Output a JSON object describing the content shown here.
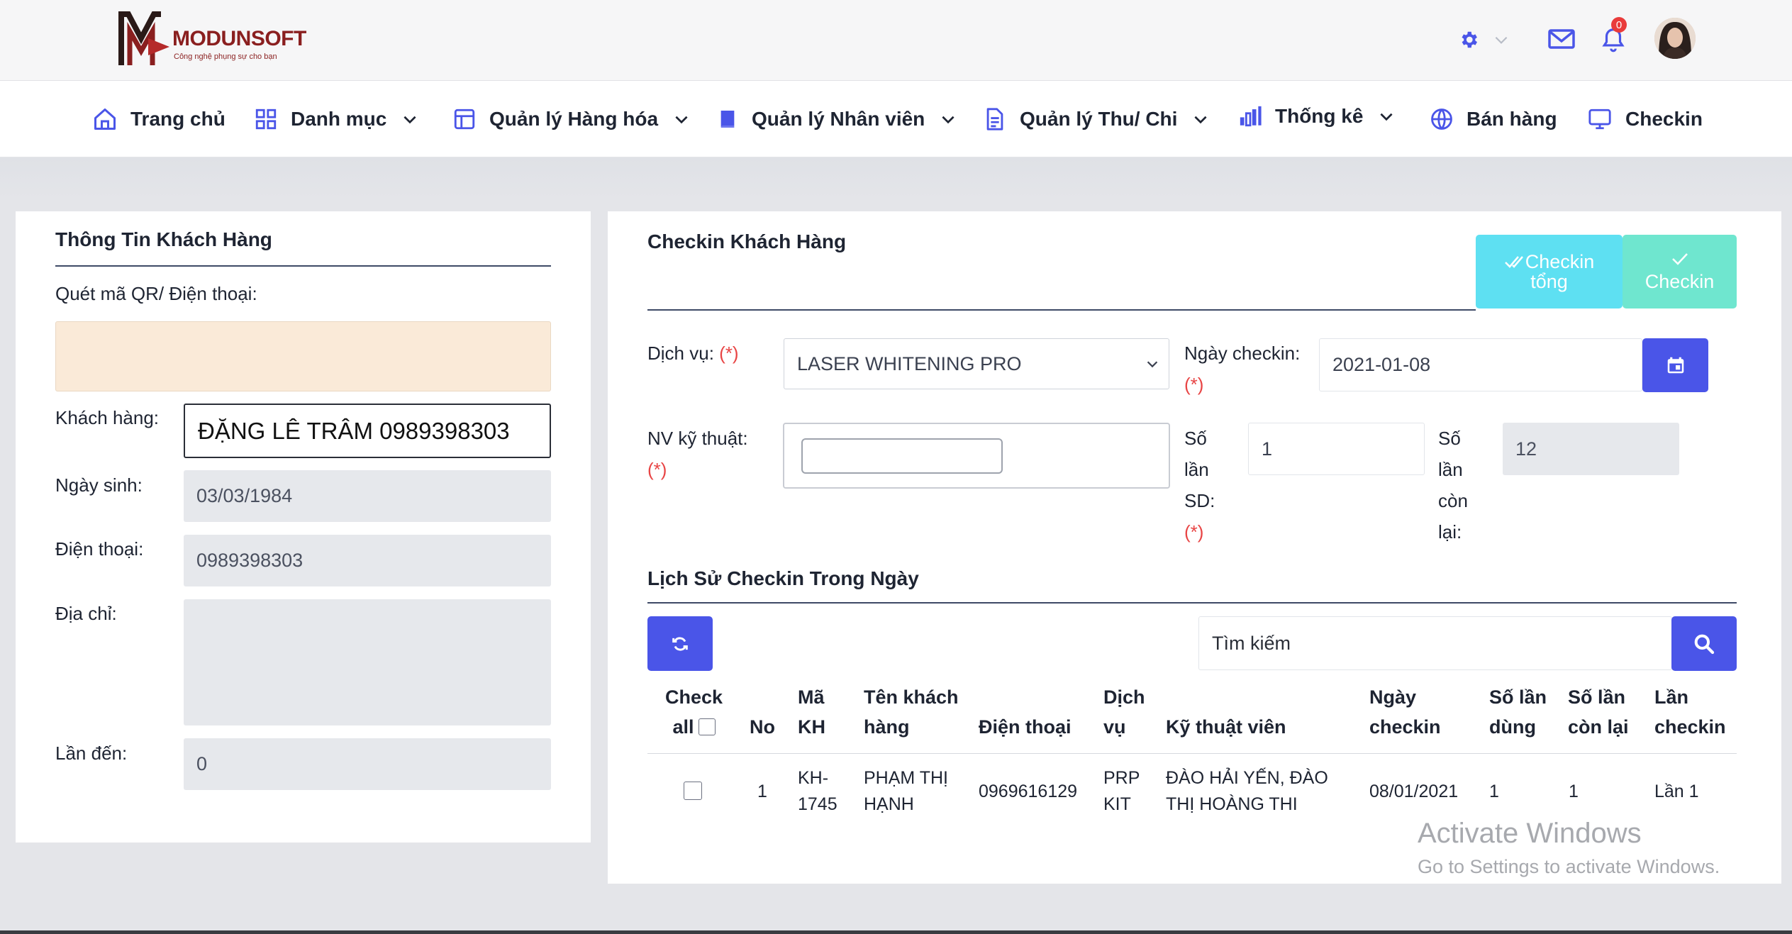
{
  "brand": {
    "name": "MODUNSOFT",
    "tagline": "Công nghệ phụng sự cho bạn"
  },
  "header": {
    "notification_count": "0"
  },
  "nav": {
    "items": [
      {
        "label": "Trang chủ"
      },
      {
        "label": "Danh mục"
      },
      {
        "label": "Quản lý Hàng hóa"
      },
      {
        "label": "Quản lý Nhân viên"
      },
      {
        "label": "Quản lý Thu/ Chi"
      },
      {
        "label": "Thống kê"
      },
      {
        "label": "Bán hàng"
      },
      {
        "label": "Checkin"
      }
    ]
  },
  "customer_panel": {
    "title": "Thông Tin Khách Hàng",
    "qr_label": "Quét mã QR/ Điện thoại:",
    "qr_value": "",
    "customer_label": "Khách hàng:",
    "customer_value": "ĐẶNG LÊ TRÂM 0989398303",
    "birth_label": "Ngày sinh:",
    "birth_value": "03/03/1984",
    "phone_label": "Điện thoại:",
    "phone_value": "0989398303",
    "address_label": "Địa chỉ:",
    "address_value": "",
    "visits_label": "Lần đến:",
    "visits_value": "0"
  },
  "checkin_panel": {
    "title": "Checkin Khách Hàng",
    "btn_total_line1": "Checkin",
    "btn_total_line2": "tổng",
    "btn_checkin": "Checkin",
    "service_label": "Dịch vụ:",
    "required_mark": "(*)",
    "service_value": "LASER WHITENING PRO",
    "date_label": "Ngày checkin:",
    "date_value": "2021-01-08",
    "tech_label": "NV kỹ thuật:",
    "tech_value": "",
    "used_label": [
      "Số",
      "lần",
      "SD:"
    ],
    "used_value": "1",
    "remain_label": [
      "Số",
      "lần",
      "còn",
      "lại:"
    ],
    "remain_value": "12"
  },
  "history": {
    "title": "Lịch Sử Checkin Trong Ngày",
    "search_placeholder": "Tìm kiếm",
    "columns": {
      "check": [
        "Check",
        "all"
      ],
      "no": "No",
      "code": [
        "Mã",
        "KH"
      ],
      "name": [
        "Tên khách",
        "hàng"
      ],
      "phone": "Điện thoại",
      "service": [
        "Dịch",
        "vụ"
      ],
      "tech": "Kỹ thuật viên",
      "date": [
        "Ngày",
        "checkin"
      ],
      "used": [
        "Số lần",
        "dùng"
      ],
      "remain": [
        "Số lần",
        "còn lại"
      ],
      "times": [
        "Lần",
        "checkin"
      ]
    },
    "rows": [
      {
        "no": "1",
        "code": [
          "KH-",
          "1745"
        ],
        "name": [
          "PHẠM THỊ",
          "HẠNH"
        ],
        "phone": "0969616129",
        "service": [
          "PRP",
          "KIT"
        ],
        "tech": [
          "ĐÀO HẢI YẾN, ĐÀO",
          "THỊ HOÀNG THI"
        ],
        "date": "08/01/2021",
        "used": "1",
        "remain": "1",
        "times": "Lần 1"
      }
    ]
  },
  "watermark": {
    "line1": "Activate Windows",
    "line2": "Go to Settings to activate Windows."
  },
  "colors": {
    "primary": "#4a55e8",
    "cyan": "#5ee0f2",
    "mint": "#6fe6cf",
    "qr_bg": "#faead8"
  }
}
